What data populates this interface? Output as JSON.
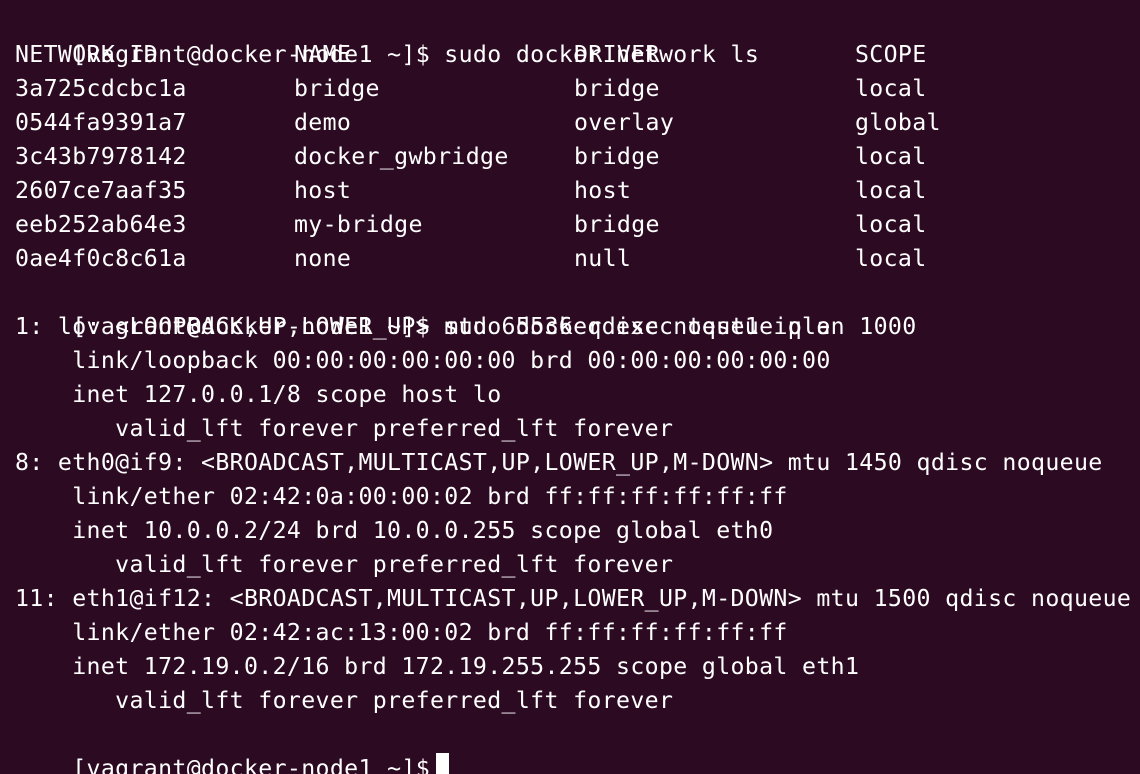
{
  "terminal": {
    "prompt1": "[vagrant@docker-node1 ~]$ sudo docker network ls",
    "network_table": {
      "headers": [
        "NETWORK ID",
        "NAME",
        "DRIVER",
        "SCOPE"
      ],
      "rows": [
        [
          "3a725cdcbc1a",
          "bridge",
          "bridge",
          "local"
        ],
        [
          "0544fa9391a7",
          "demo",
          "overlay",
          "global"
        ],
        [
          "3c43b7978142",
          "docker_gwbridge",
          "bridge",
          "local"
        ],
        [
          "2607ce7aaf35",
          "host",
          "host",
          "local"
        ],
        [
          "eeb252ab64e3",
          "my-bridge",
          "bridge",
          "local"
        ],
        [
          "0ae4f0c8c61a",
          "none",
          "null",
          "local"
        ]
      ]
    },
    "prompt2": "[vagrant@docker-node1 ~]$ sudo docker exec test1 ip a",
    "ip_output": [
      "1: lo: <LOOPBACK,UP,LOWER_UP> mtu 65536 qdisc noqueue qlen 1000",
      "    link/loopback 00:00:00:00:00:00 brd 00:00:00:00:00:00",
      "    inet 127.0.0.1/8 scope host lo",
      "       valid_lft forever preferred_lft forever",
      "8: eth0@if9: <BROADCAST,MULTICAST,UP,LOWER_UP,M-DOWN> mtu 1450 qdisc noqueue",
      "    link/ether 02:42:0a:00:00:02 brd ff:ff:ff:ff:ff:ff",
      "    inet 10.0.0.2/24 brd 10.0.0.255 scope global eth0",
      "       valid_lft forever preferred_lft forever",
      "11: eth1@if12: <BROADCAST,MULTICAST,UP,LOWER_UP,M-DOWN> mtu 1500 qdisc noqueue",
      "    link/ether 02:42:ac:13:00:02 brd ff:ff:ff:ff:ff:ff",
      "    inet 172.19.0.2/16 brd 172.19.255.255 scope global eth1",
      "       valid_lft forever preferred_lft forever"
    ],
    "prompt3": "[vagrant@docker-node1 ~]$"
  },
  "colors": {
    "background": "#2c0a22",
    "text": "#ffffff",
    "cursor": "#ffffff"
  }
}
